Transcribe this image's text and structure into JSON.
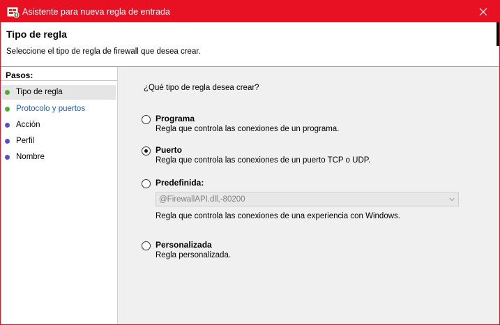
{
  "window": {
    "title": "Asistente para nueva regla de entrada",
    "accent_color": "#e81123",
    "icon": "firewall-rule-icon"
  },
  "header": {
    "title": "Tipo de regla",
    "subtitle": "Seleccione el tipo de regla de firewall que desea crear."
  },
  "steps": {
    "heading": "Pasos:",
    "items": [
      {
        "label": "Tipo de regla",
        "state": "current",
        "color": "#4caf33"
      },
      {
        "label": "Protocolo y puertos",
        "state": "link",
        "color": "#4caf33"
      },
      {
        "label": "Acción",
        "state": "pending",
        "color": "#5a4fc9"
      },
      {
        "label": "Perfil",
        "state": "pending",
        "color": "#5a4fc9"
      },
      {
        "label": "Nombre",
        "state": "pending",
        "color": "#5a4fc9"
      }
    ]
  },
  "content": {
    "question": "¿Qué tipo de regla desea crear?",
    "options": [
      {
        "label": "Programa",
        "description": "Regla que controla las conexiones de un programa.",
        "selected": false
      },
      {
        "label": "Puerto",
        "description": "Regla que controla las conexiones de un puerto TCP o UDP.",
        "selected": true
      },
      {
        "label": "Predefinida:",
        "description": "Regla que controla las conexiones de una experiencia con Windows.",
        "selected": false
      },
      {
        "label": "Personalizada",
        "description": "Regla personalizada.",
        "selected": false
      }
    ],
    "predefined_select": {
      "value": "@FirewallAPI.dll,-80200",
      "disabled": true
    }
  }
}
